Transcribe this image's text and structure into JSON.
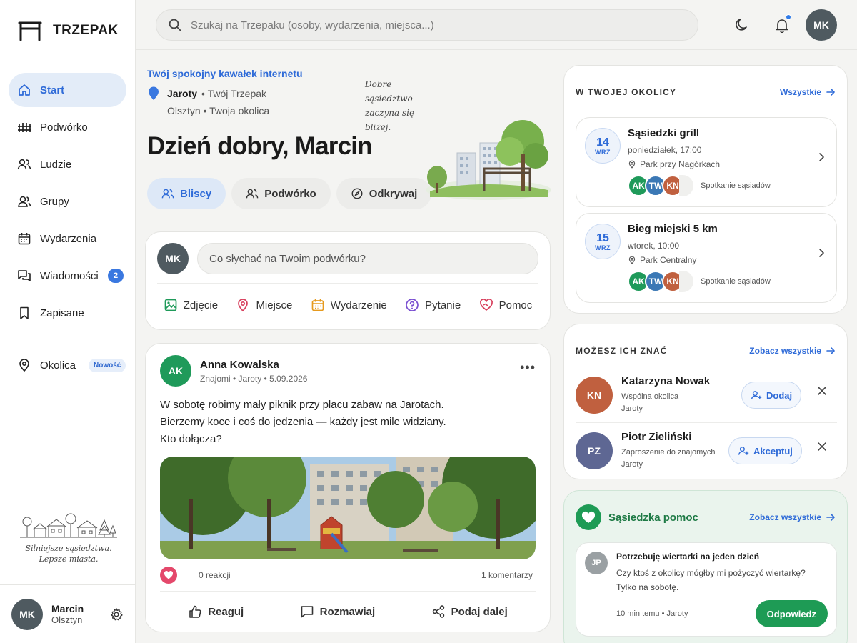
{
  "brand": {
    "name": "TRZEPAK"
  },
  "sidebar": {
    "items": [
      {
        "label": "Start"
      },
      {
        "label": "Podwórko"
      },
      {
        "label": "Ludzie"
      },
      {
        "label": "Grupy"
      },
      {
        "label": "Wydarzenia"
      },
      {
        "label": "Wiadomości",
        "badge": "2"
      },
      {
        "label": "Zapisane"
      }
    ],
    "area": {
      "label": "Okolica",
      "badge": "Nowość"
    },
    "tagline_1": "Silniejsze sąsiedztwa.",
    "tagline_2": "Lepsze miasta.",
    "user": {
      "initials": "MK",
      "name": "Marcin",
      "city": "Olsztyn"
    }
  },
  "topbar": {
    "search_placeholder": "Szukaj na Trzepaku (osoby, wydarzenia, miejsca...)",
    "user_initials": "MK"
  },
  "hero": {
    "tagline": "Twój spokojny kawałek internetu",
    "location": "Jaroty",
    "location_sub": "• Twój Trzepak",
    "city_line": "Olsztyn • Twoja okolica",
    "quote": "Dobre sąsiedztwo zaczyna się bliżej.",
    "greeting": "Dzień dobry, Marcin",
    "pills": [
      "Bliscy",
      "Podwórko",
      "Odkrywaj"
    ]
  },
  "composer": {
    "initials": "MK",
    "placeholder": "Co słychać na Twoim podwórku?",
    "actions": [
      "Zdjęcie",
      "Miejsce",
      "Wydarzenie",
      "Pytanie",
      "Pomoc"
    ]
  },
  "post": {
    "initials": "AK",
    "author": "Anna Kowalska",
    "meta": "Znajomi • Jaroty • 5.09.2026",
    "more": "•••",
    "lines": [
      "W sobotę robimy mały piknik przy placu zabaw na Jarotach.",
      "Bierzemy koce i coś do jedzenia — każdy jest mile widziany.",
      "Kto dołącza?"
    ],
    "reactions": "0 reakcji",
    "comments": "1 komentarzy",
    "actions": [
      "Reaguj",
      "Rozmawiaj",
      "Podaj dalej"
    ]
  },
  "events": {
    "title": "W TWOJEJ OKOLICY",
    "link": "Wszystkie",
    "items": [
      {
        "day": "14",
        "month": "WRZ",
        "title": "Sąsiedzki grill",
        "time": "poniedziałek, 17:00",
        "place": "Park przy Nagórkach",
        "attendees": [
          "AK",
          "TW",
          "KN"
        ],
        "label": "Spotkanie sąsiadów"
      },
      {
        "day": "15",
        "month": "WRZ",
        "title": "Bieg miejski 5 km",
        "time": "wtorek, 10:00",
        "place": "Park Centralny",
        "attendees": [
          "AK",
          "TW",
          "KN"
        ],
        "label": "Spotkanie sąsiadów"
      }
    ]
  },
  "people": {
    "title": "MOŻESZ ICH ZNAĆ",
    "link": "Zobacz wszystkie",
    "items": [
      {
        "initials": "KN",
        "name": "Katarzyna Nowak",
        "reason": "Wspólna okolica",
        "area": "Jaroty",
        "action": "Dodaj"
      },
      {
        "initials": "PZ",
        "name": "Piotr Zieliński",
        "reason": "Zaproszenie do znajomych",
        "area": "Jaroty",
        "action": "Akceptuj"
      }
    ]
  },
  "help": {
    "title": "Sąsiedzka pomoc",
    "link": "Zobacz wszystkie",
    "initials": "JP",
    "question": "Potrzebuję wiertarki na jeden dzień",
    "body_1": "Czy ktoś z okolicy mógłby mi pożyczyć wiertarkę?",
    "body_2": "Tylko na sobotę.",
    "meta": "10 min temu • Jaroty",
    "reply": "Odpowiedz"
  },
  "colors": {
    "accent": "#2f6bd8",
    "green": "#1e9b55",
    "avatar_mk": "#4f5a60",
    "avatar_ak": "#1f9a5a",
    "avatar_tw": "#3b78b5",
    "avatar_kn": "#c0603f",
    "avatar_pz": "#5e6793",
    "avatar_jp": "#9aa0a3"
  }
}
